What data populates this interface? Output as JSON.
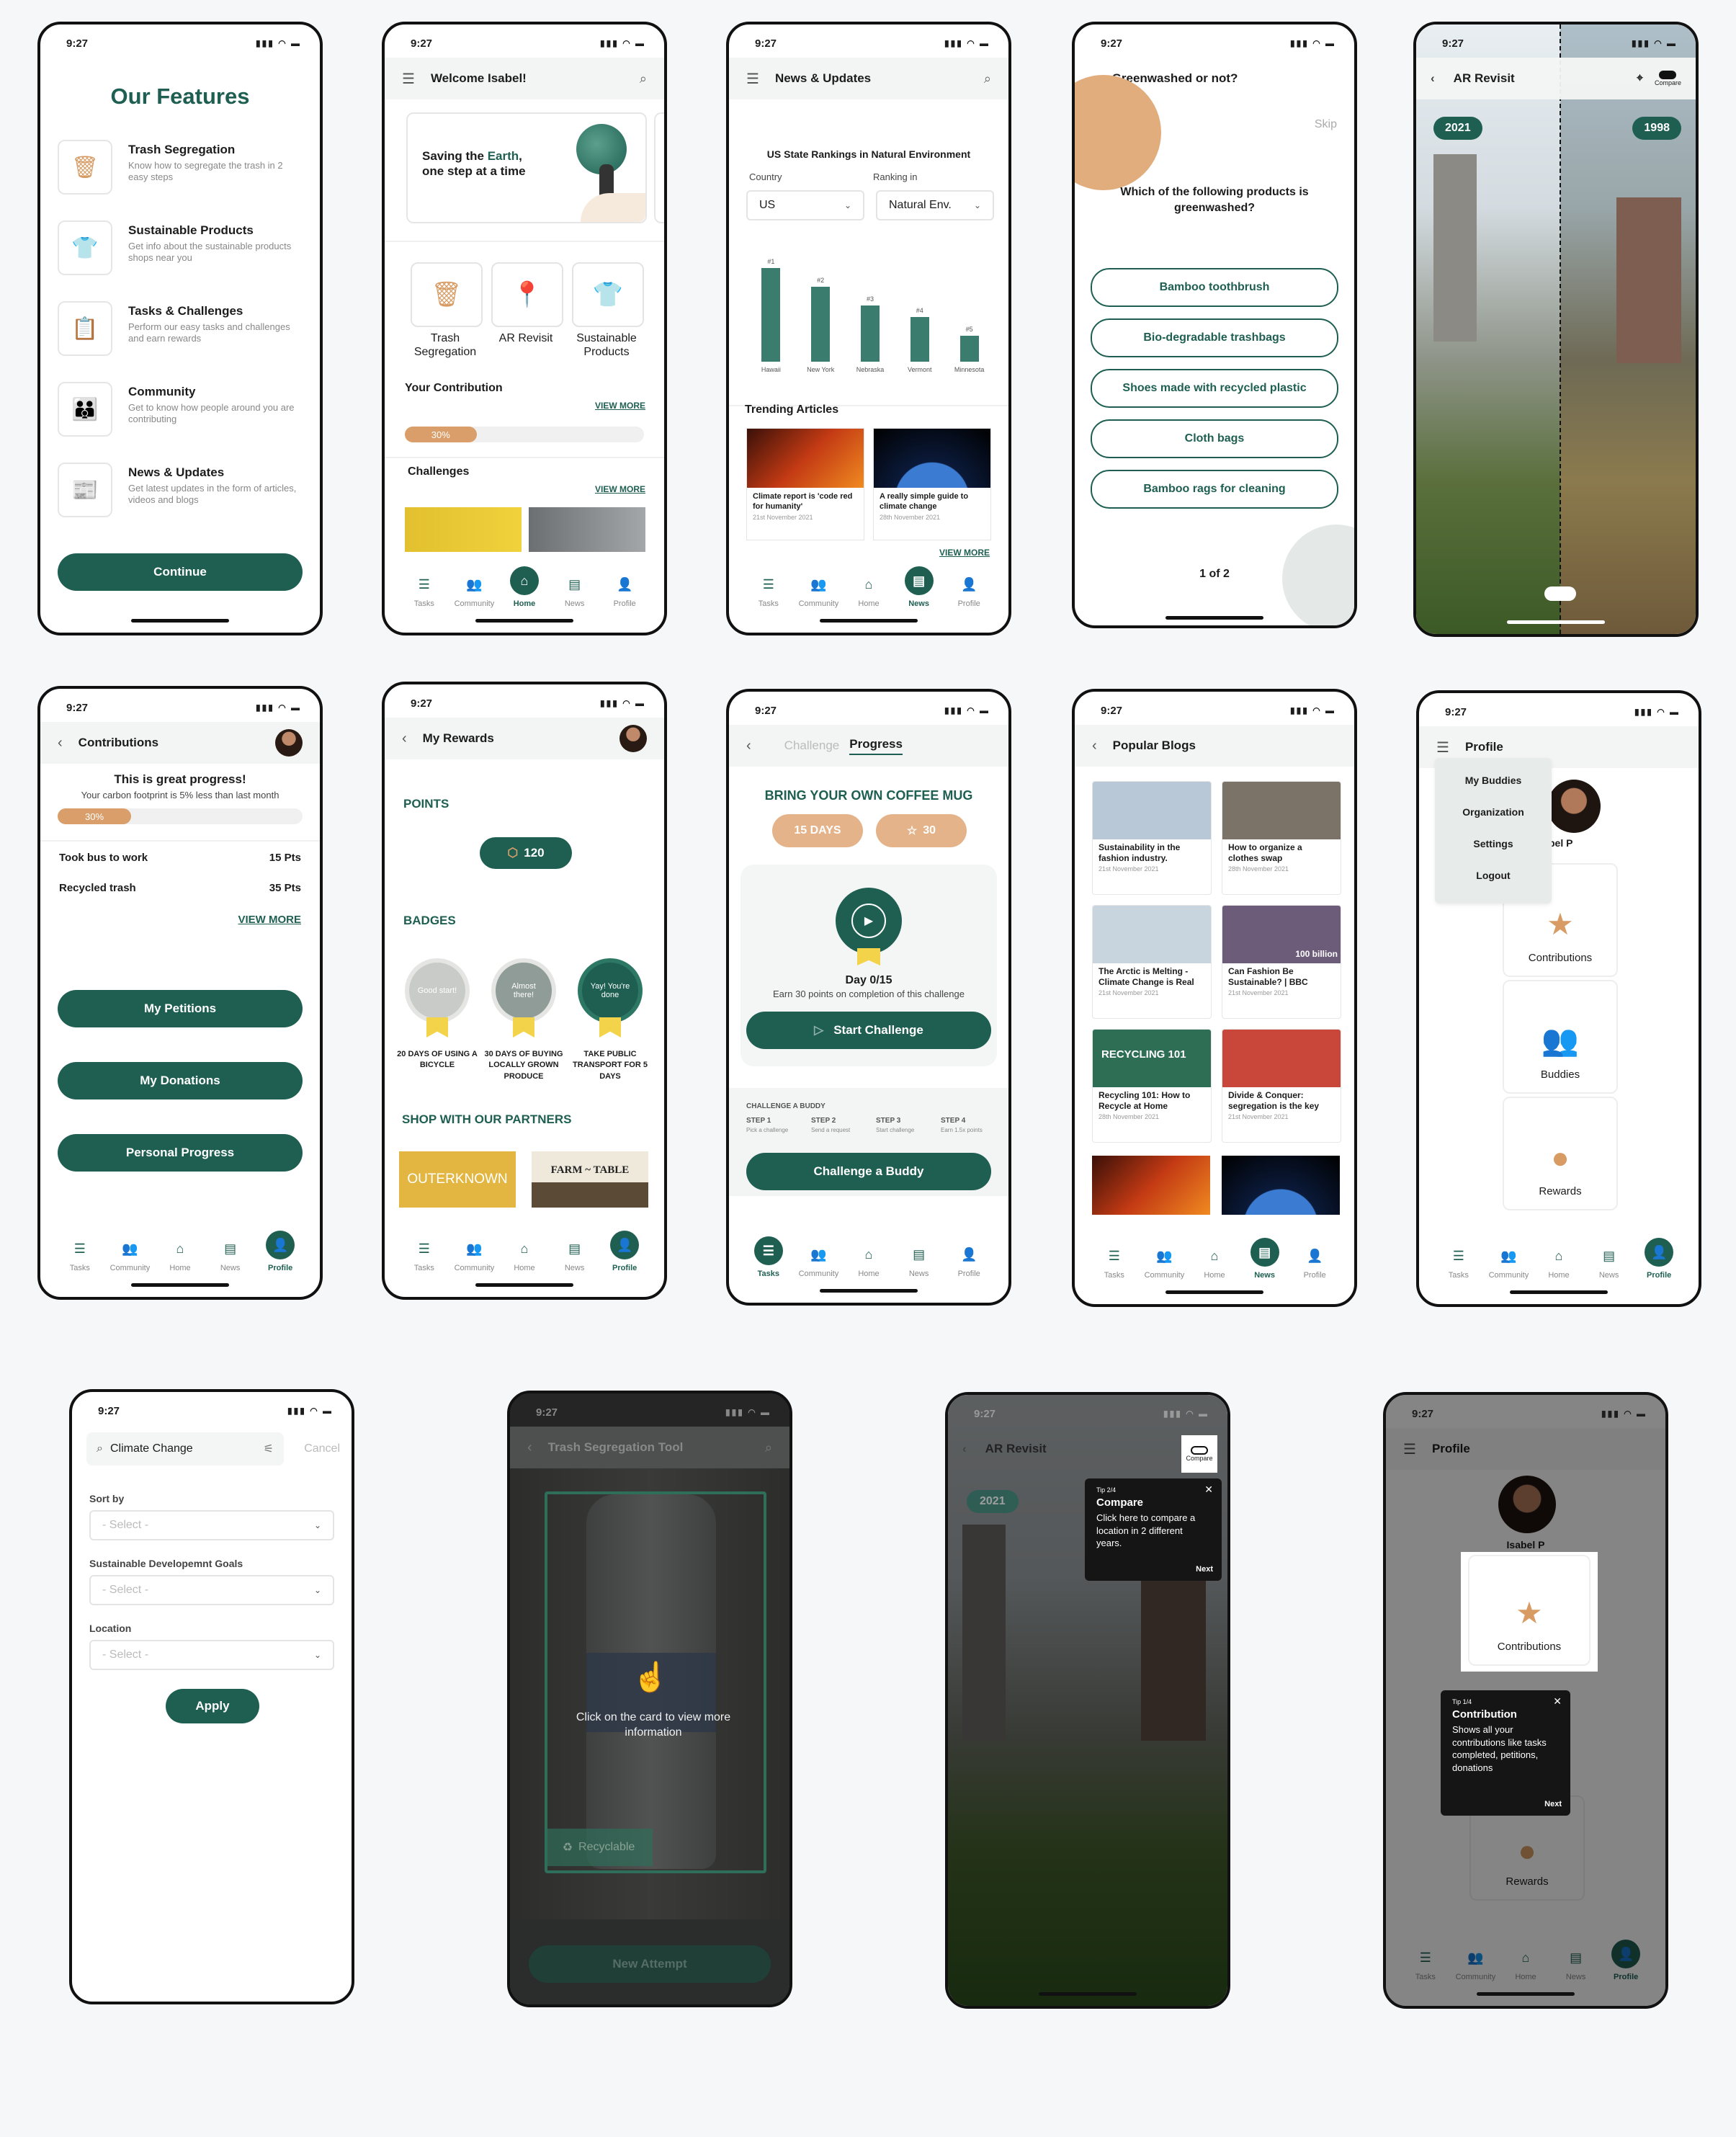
{
  "status_time": "9:27",
  "tabs": [
    "Tasks",
    "Community",
    "Home",
    "News",
    "Profile"
  ],
  "s1": {
    "title": "Our Features",
    "features": [
      {
        "title": "Trash Segregation",
        "desc": "Know how to segregate the trash in 2 easy steps",
        "icon": "trash-icon"
      },
      {
        "title": "Sustainable Products",
        "desc": "Get info about the sustainable products shops near you",
        "icon": "tshirt-icon"
      },
      {
        "title": "Tasks & Challenges",
        "desc": "Perform our easy tasks and challenges and earn rewards",
        "icon": "clipboard-icon"
      },
      {
        "title": "Community",
        "desc": "Get to know how people around you are contributing",
        "icon": "people-icon"
      },
      {
        "title": "News & Updates",
        "desc": "Get latest updates in the form of articles, videos and blogs",
        "icon": "news-icon"
      }
    ],
    "continue": "Continue"
  },
  "s2": {
    "title": "Welcome Isabel!",
    "banner_pre": "Saving the ",
    "banner_hl": "Earth",
    "banner_post": ",",
    "banner_line2": "one step at a time",
    "cards": [
      "Trash Segregation",
      "AR Revisit",
      "Sustainable Products"
    ],
    "contribution": "Your Contribution",
    "view_more": "VIEW MORE",
    "progress": "30%",
    "progress_value": 30,
    "challenges": "Challenges"
  },
  "s3": {
    "title": "News & Updates",
    "chart_title": "US State Rankings in Natural Environment",
    "country_label": "Country",
    "ranking_label": "Ranking in",
    "country_value": "US",
    "ranking_value": "Natural Env.",
    "trending": "Trending Articles",
    "articles": [
      {
        "title": "Climate report is 'code red for humanity'",
        "date": "21st November 2021"
      },
      {
        "title": "A really simple guide to climate change",
        "date": "28th November 2021"
      }
    ],
    "view_more": "VIEW MORE"
  },
  "chart_data": {
    "type": "bar",
    "title": "US State Rankings in Natural Environment",
    "categories": [
      "Hawaii",
      "New York",
      "Nebraska",
      "Vermont",
      "Minnesota"
    ],
    "rank_labels": [
      "#1",
      "#2",
      "#3",
      "#4",
      "#5"
    ],
    "values": [
      5,
      4,
      3,
      2.4,
      1.4
    ]
  },
  "s4": {
    "title": "Greenwashed or not?",
    "skip": "Skip",
    "question": "Which of the following products is greenwashed?",
    "options": [
      "Bamboo toothbrush",
      "Bio-degradable trashbags",
      "Shoes made with recycled plastic",
      "Cloth bags",
      "Bamboo rags for cleaning"
    ],
    "pager": "1 of 2"
  },
  "s5": {
    "title": "AR Revisit",
    "compare": "Compare",
    "year_left": "2021",
    "year_right": "1998"
  },
  "s6": {
    "title": "Contributions",
    "headline": "This is great progress!",
    "sub": "Your carbon footprint is 5% less than last month",
    "progress": "30%",
    "progress_value": 30,
    "rows": [
      {
        "label": "Took bus to work",
        "pts": "15 Pts"
      },
      {
        "label": "Recycled trash",
        "pts": "35 Pts"
      }
    ],
    "view_more": "VIEW MORE",
    "buttons": [
      "My Petitions",
      "My Donations",
      "Personal Progress"
    ]
  },
  "s7": {
    "title": "My Rewards",
    "points_title": "POINTS",
    "points": "120",
    "badges_title": "BADGES",
    "badges": [
      {
        "inner": "Good start!",
        "label": "20 DAYS OF USING A BICYCLE"
      },
      {
        "inner": "Almost there!",
        "label": "30 DAYS OF BUYING LOCALLY GROWN PRODUCE"
      },
      {
        "inner": "Yay! You're done",
        "label": "TAKE PUBLIC TRANSPORT FOR 5 DAYS"
      }
    ],
    "shop_title": "SHOP WITH OUR PARTNERS",
    "partners": [
      "OUTERKNOWN",
      "FARM ~ TABLE"
    ]
  },
  "s8": {
    "tab_challenge": "Challenge",
    "tab_progress": "Progress",
    "headline": "BRING YOUR OWN COFFEE MUG",
    "days": "15 DAYS",
    "stars": "30",
    "day": "Day 0/15",
    "earn": "Earn 30 points on completion of this challenge",
    "start": "Start Challenge",
    "buddy_title": "CHALLENGE A BUDDY",
    "steps": [
      {
        "t": "STEP 1",
        "d": "Pick a challenge"
      },
      {
        "t": "STEP 2",
        "d": "Send a request"
      },
      {
        "t": "STEP 3",
        "d": "Start challenge"
      },
      {
        "t": "STEP 4",
        "d": "Earn 1.5x points"
      }
    ],
    "buddy_btn": "Challenge a Buddy"
  },
  "s9": {
    "title": "Popular Blogs",
    "blogs": [
      {
        "title": "Sustainability in the fashion industry.",
        "date": "21st November 2021",
        "c": "#b9c8d6"
      },
      {
        "title": "How to organize a clothes swap",
        "date": "28th November 2021",
        "c": "#7c7368"
      },
      {
        "title": "The Arctic is Melting - Climate Change is Real",
        "date": "21st November 2021",
        "c": "#c9d5de"
      },
      {
        "title": "Can Fashion Be Sustainable? | BBC",
        "date": "21st November 2021",
        "c": "#6d5c79"
      },
      {
        "title": "Recycling 101: How to Recycle at Home",
        "date": "28th November 2021",
        "c": "#2e6e55"
      },
      {
        "title": "Divide & Conquer: segregation is the key",
        "date": "21st November 2021",
        "c": "#c9463a"
      }
    ],
    "img_text_billion": "100 billion",
    "img_text_recycling": "RECYCLING 101"
  },
  "s10": {
    "title": "Profile",
    "menu": [
      "My Buddies",
      "Organization",
      "Settings",
      "Logout"
    ],
    "name_partial": "bel P",
    "cards": [
      "Contributions",
      "Buddies",
      "Rewards"
    ]
  },
  "s11": {
    "search": "Climate Change",
    "cancel": "Cancel",
    "sort_by": "Sort by",
    "sdg": "Sustainable Developemnt Goals",
    "location": "Location",
    "select": "- Select -",
    "apply": "Apply"
  },
  "s12": {
    "title": "Trash Segregation Tool",
    "hint": "Click on the card to view more information",
    "recyclable": "Recyclable",
    "new_attempt": "New Attempt"
  },
  "s13": {
    "title": "AR Revisit",
    "compare": "Compare",
    "year": "2021",
    "tip_step": "Tip 2/4",
    "tip_title": "Compare",
    "tip_body": "Click here to compare a location in 2 different years.",
    "next": "Next"
  },
  "s14": {
    "title": "Profile",
    "name": "Isabel P",
    "card": "Contributions",
    "rewards": "Rewards",
    "tip_step": "Tip 1/4",
    "tip_title": "Contribution",
    "tip_body": "Shows all your contributions like tasks completed, petitions, donations",
    "next": "Next"
  }
}
